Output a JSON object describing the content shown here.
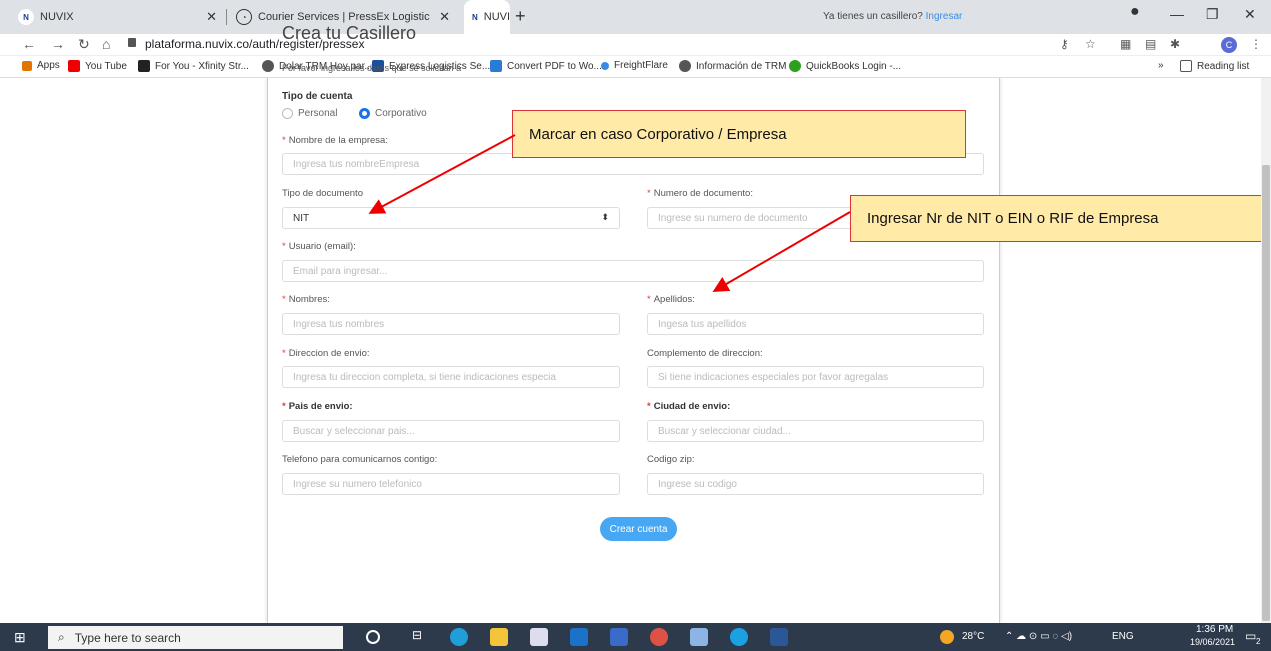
{
  "browser": {
    "tabs": [
      {
        "title": "NUVIX",
        "favicon": "N"
      },
      {
        "title": "Courier Services | PressEx Logistic",
        "favicon": "C"
      },
      {
        "title": "NUVIX",
        "favicon": "N"
      }
    ],
    "url": "plataforma.nuvix.co/auth/register/pressex",
    "profile_initial": "C",
    "bookmarks": [
      "Apps",
      "You Tube",
      "For You - Xfinity Str...",
      "Dolar TRM Hoy par...",
      "Express Logistics Se...",
      "Convert PDF to Wo...",
      "FreightFlare",
      "Información de TRM",
      "QuickBooks Login -..."
    ],
    "bookmarks_overflow": "»",
    "reading_list": "Reading list"
  },
  "page": {
    "have_account": "Ya tienes un casillero?",
    "login_link": "Ingresar",
    "title": "Crea tu Casillero",
    "subtitle": "Por favor ingresa los datos que se solicitan a",
    "account_type_label": "Tipo de cuenta",
    "account_types": [
      "Personal",
      "Corporativo"
    ],
    "company_name": {
      "label": "Nombre de la empresa:",
      "placeholder": "Ingresa tus nombreEmpresa"
    },
    "doc_type": {
      "label": "Tipo de documento",
      "value": "NIT"
    },
    "doc_number": {
      "label": "Numero de documento:",
      "placeholder": "Ingrese su numero de documento"
    },
    "user_email": {
      "label": "Usuario (email):",
      "placeholder": "Email para ingresar..."
    },
    "first_names": {
      "label": "Nombres:",
      "placeholder": "Ingresa tus nombres"
    },
    "last_names": {
      "label": "Apellidos:",
      "placeholder": "Ingesa tus apellidos"
    },
    "address": {
      "label": "Direccion de envio:",
      "placeholder": "Ingresa tu direccion completa, si tiene indicaciones especia"
    },
    "address_extra": {
      "label": "Complemento de direccion:",
      "placeholder": "Si tiene indicaciones especiales por favor agregalas"
    },
    "country": {
      "label": "Pais de envio:",
      "placeholder": "Buscar y seleccionar pais..."
    },
    "city": {
      "label": "Ciudad de envio:",
      "placeholder": "Buscar y seleccionar ciudad..."
    },
    "phone": {
      "label": "Telefono para comunicarnos contigo:",
      "placeholder": "Ingrese su numero telefonico"
    },
    "zip": {
      "label": "Codigo zip:",
      "placeholder": "Ingrese su codigo"
    },
    "submit": "Crear cuenta"
  },
  "annotations": {
    "callout_1": "Marcar en caso Corporativo / Empresa",
    "callout_2": "Ingresar Nr de NIT o EIN o RIF de Empresa"
  },
  "taskbar": {
    "search_placeholder": "Type here to search",
    "temperature": "28°C",
    "language": "ENG",
    "time": "1:36 PM",
    "date": "19/06/2021",
    "notification_count": "2"
  },
  "colors": {
    "accent": "#1a73e8",
    "button": "#47a7f2",
    "callout_bg": "#ffeaa7",
    "callout_border": "#dd3333",
    "required": "#e53935"
  }
}
